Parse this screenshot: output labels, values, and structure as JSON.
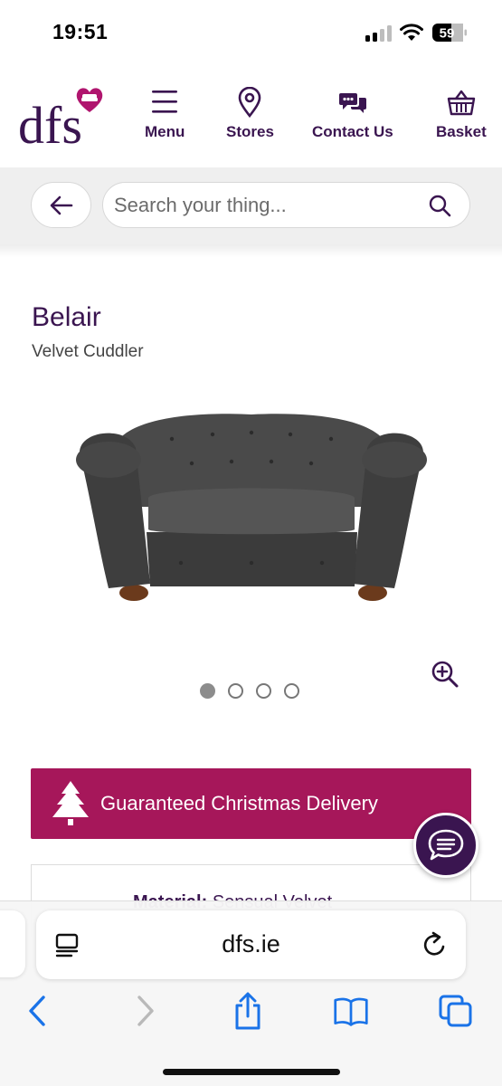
{
  "status_bar": {
    "time": "19:51",
    "battery": "59"
  },
  "header": {
    "logo_text": "dfs",
    "nav": [
      {
        "label": "Menu",
        "icon": "menu-icon"
      },
      {
        "label": "Stores",
        "icon": "location-pin-icon"
      },
      {
        "label": "Contact Us",
        "icon": "chat-bubbles-icon"
      },
      {
        "label": "Basket",
        "icon": "basket-icon"
      }
    ]
  },
  "search": {
    "placeholder": "Search your thing..."
  },
  "product": {
    "title": "Belair",
    "subtitle": "Velvet Cuddler",
    "image_count": 4,
    "active_image": 1
  },
  "banner": {
    "text": "Guaranteed Christmas Delivery",
    "color": "#a6175a"
  },
  "material": {
    "label": "Material:",
    "value": "Sensual Velvet"
  },
  "browser": {
    "url": "dfs.ie"
  },
  "colors": {
    "brand_purple": "#3a1550",
    "accent_pink": "#b0156e",
    "ios_blue": "#1a73e8"
  }
}
